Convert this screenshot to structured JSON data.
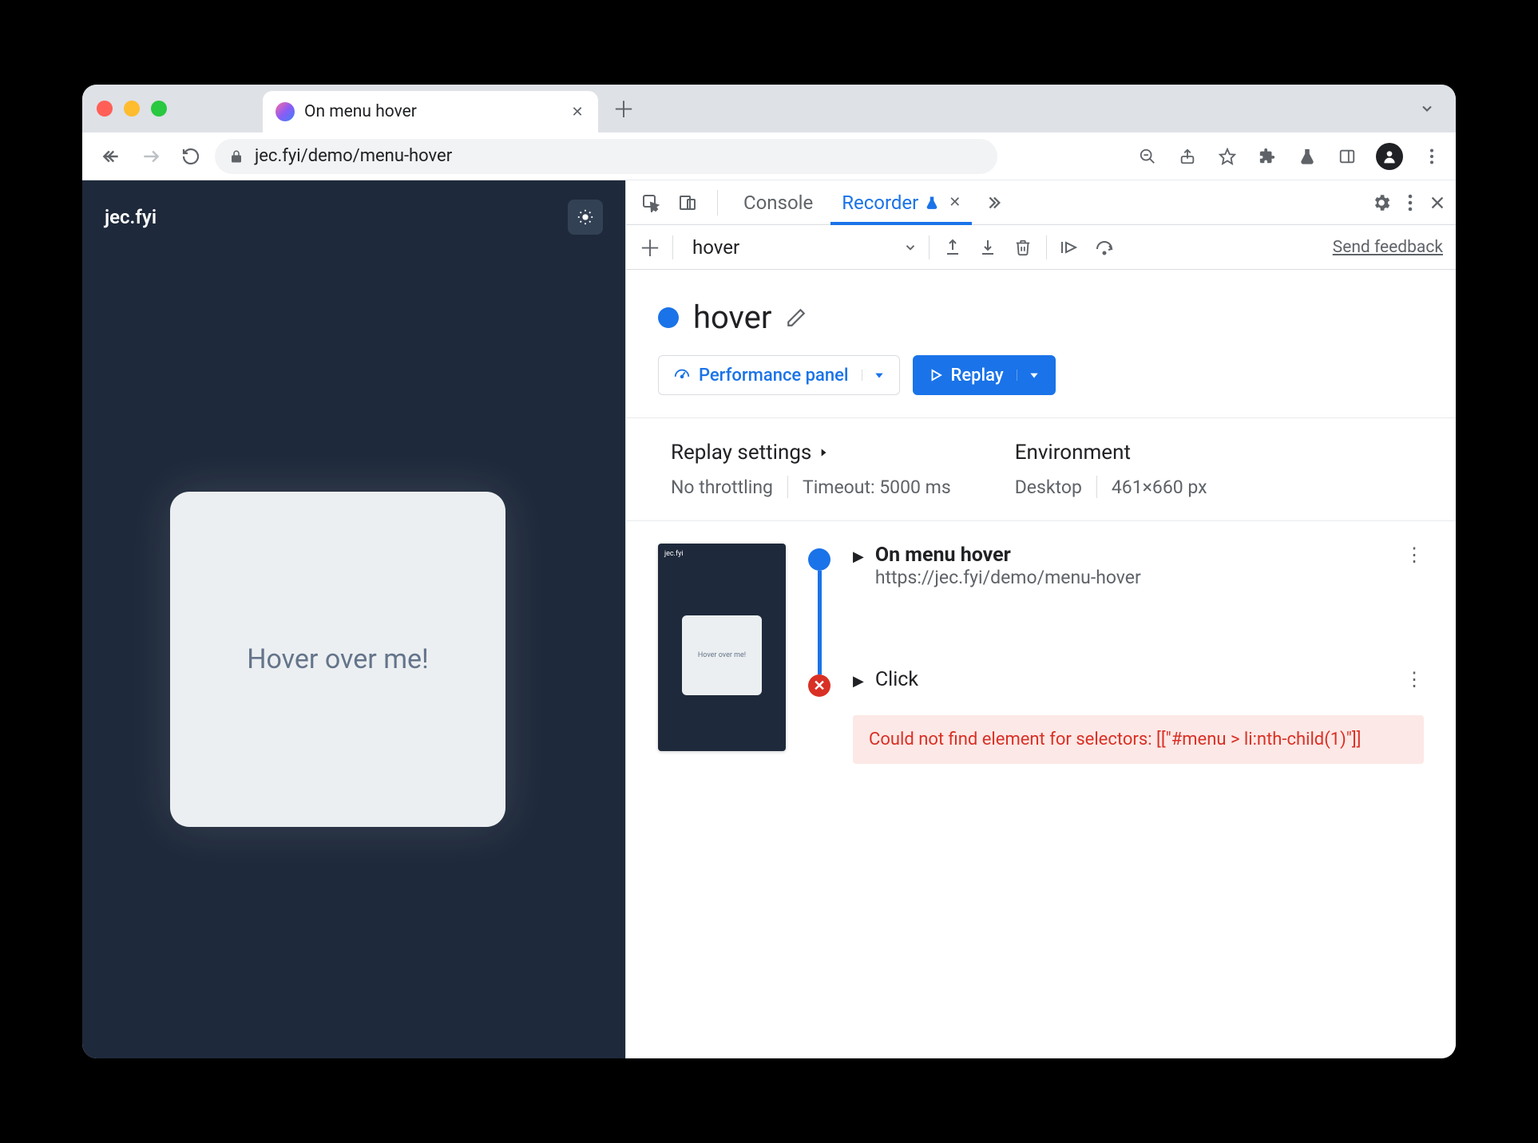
{
  "tab": {
    "title": "On menu hover"
  },
  "address": {
    "url": "jec.fyi/demo/menu-hover"
  },
  "page": {
    "brand": "jec.fyi",
    "card_text": "Hover over me!"
  },
  "devtools": {
    "tabs": {
      "console": "Console",
      "recorder": "Recorder"
    },
    "toolbar": {
      "recording_name": "hover",
      "feedback": "Send feedback"
    },
    "title": "hover",
    "perf_button": "Performance panel",
    "replay_button": "Replay",
    "settings": {
      "replay_heading": "Replay settings",
      "throttling": "No throttling",
      "timeout": "Timeout: 5000 ms",
      "env_heading": "Environment",
      "device": "Desktop",
      "dimensions": "461×660 px"
    },
    "steps": {
      "s1_title": "On menu hover",
      "s1_url": "https://jec.fyi/demo/menu-hover",
      "s2_title": "Click",
      "error": "Could not find element for selectors: [[\"#menu > li:nth-child(1)\"]]"
    },
    "thumb_text": "Hover over me!",
    "thumb_brand": "jec.fyi"
  }
}
